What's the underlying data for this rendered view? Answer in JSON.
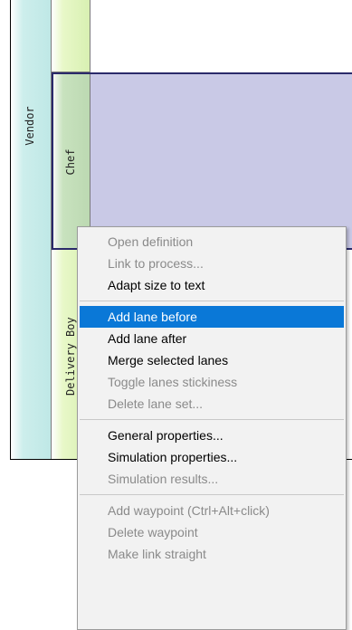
{
  "diagram": {
    "pool_label": "Vendor",
    "lanes": [
      {
        "label": ""
      },
      {
        "label": "Chef"
      },
      {
        "label": "Delivery Boy"
      }
    ]
  },
  "context_menu": {
    "groups": [
      [
        {
          "label": "Open definition",
          "enabled": false
        },
        {
          "label": "Link to process...",
          "enabled": false
        },
        {
          "label": "Adapt size to text",
          "enabled": true
        }
      ],
      [
        {
          "label": "Add lane before",
          "enabled": true,
          "highlighted": true
        },
        {
          "label": "Add lane after",
          "enabled": true
        },
        {
          "label": "Merge selected lanes",
          "enabled": true
        },
        {
          "label": "Toggle lanes stickiness",
          "enabled": false
        },
        {
          "label": "Delete lane set...",
          "enabled": false
        }
      ],
      [
        {
          "label": "General properties...",
          "enabled": true
        },
        {
          "label": "Simulation properties...",
          "enabled": true
        },
        {
          "label": "Simulation results...",
          "enabled": false
        }
      ],
      [
        {
          "label": "Add waypoint (Ctrl+Alt+click)",
          "enabled": false
        },
        {
          "label": "Delete waypoint",
          "enabled": false
        },
        {
          "label": "Make link straight",
          "enabled": false
        }
      ]
    ]
  },
  "colors": {
    "highlight": "#0a78d7",
    "chef_lane_fill": "#c9c9e6",
    "disabled_text": "#8a8a8a"
  }
}
